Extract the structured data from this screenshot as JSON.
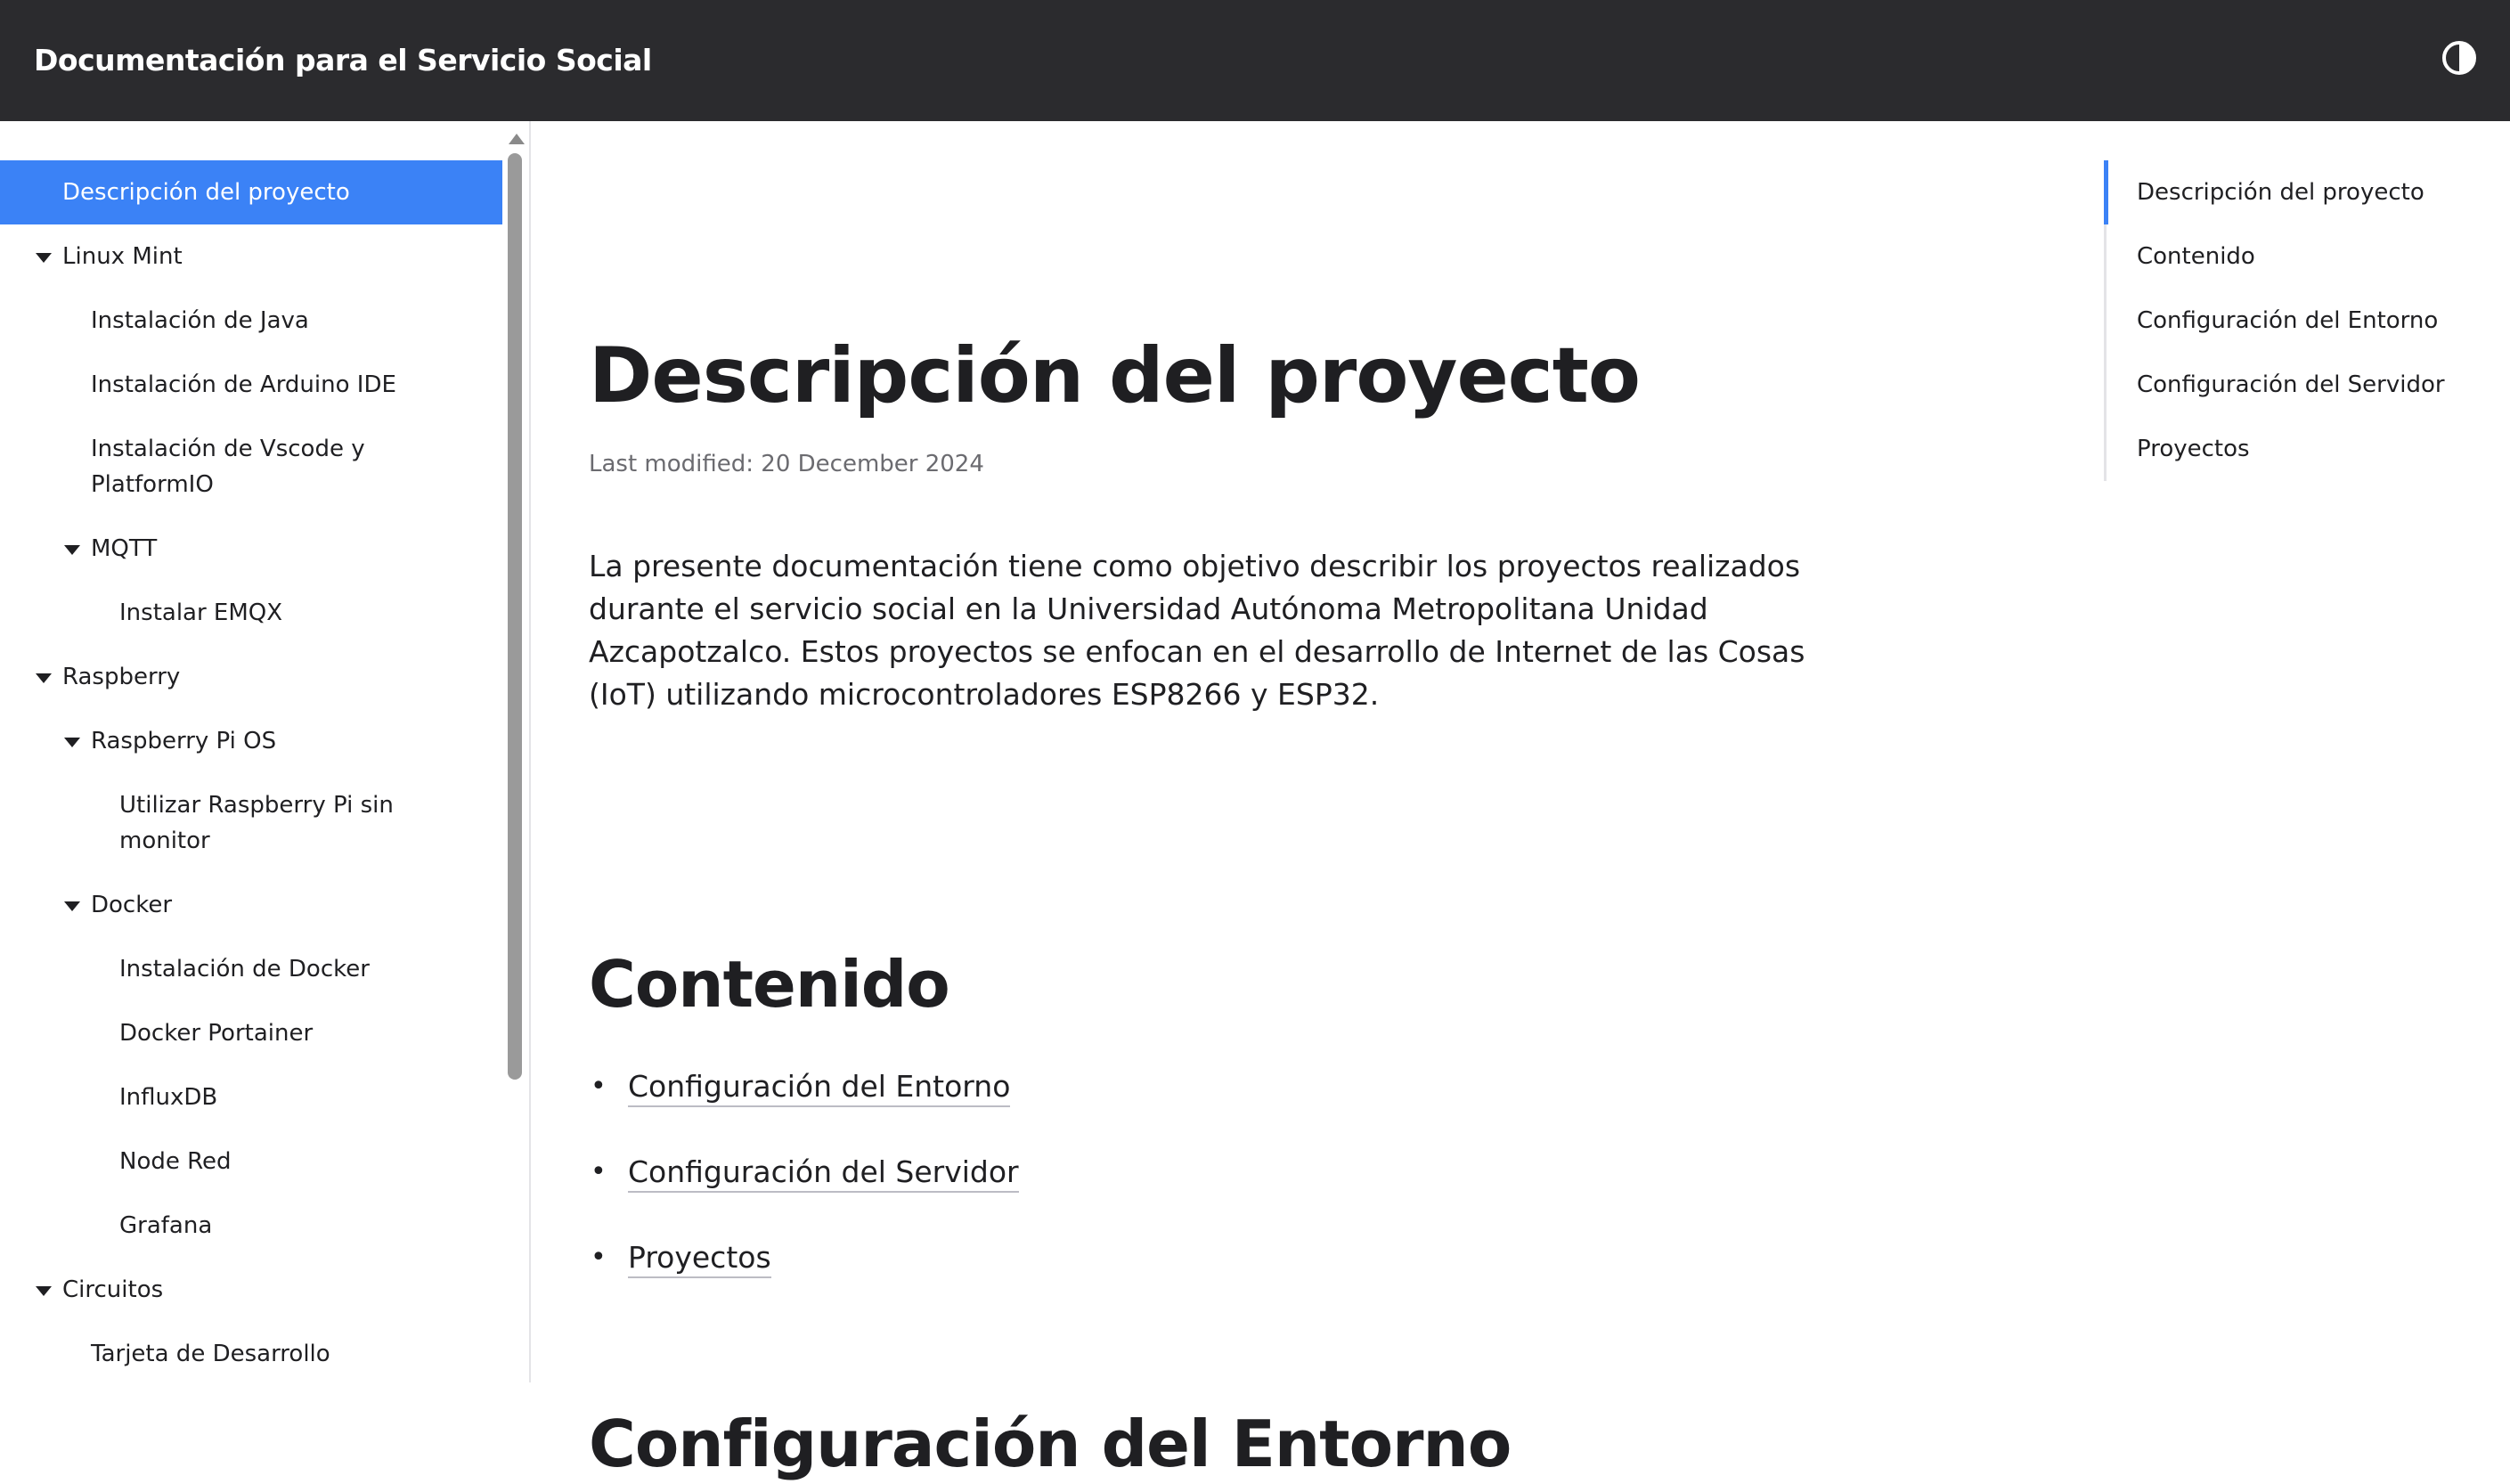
{
  "header": {
    "title": "Documentación para el Servicio Social",
    "theme_toggle_icon": "contrast-icon"
  },
  "sidebar": {
    "items": [
      {
        "label": "Descripción del proyecto"
      },
      {
        "label": "Linux Mint"
      },
      {
        "label": "Instalación de Java"
      },
      {
        "label": "Instalación de Arduino IDE"
      },
      {
        "label": "Instalación de Vscode y PlatformIO"
      },
      {
        "label": "MQTT"
      },
      {
        "label": "Instalar EMQX"
      },
      {
        "label": "Raspberry"
      },
      {
        "label": "Raspberry Pi OS"
      },
      {
        "label": "Utilizar Raspberry Pi sin monitor"
      },
      {
        "label": "Docker"
      },
      {
        "label": "Instalación de Docker"
      },
      {
        "label": "Docker Portainer"
      },
      {
        "label": "InfluxDB"
      },
      {
        "label": "Node Red"
      },
      {
        "label": "Grafana"
      },
      {
        "label": "Circuitos"
      },
      {
        "label": "Tarjeta de Desarrollo"
      }
    ]
  },
  "main": {
    "title": "Descripción del proyecto",
    "last_modified": "Last modified: 20 December 2024",
    "intro": "La presente documentación tiene como objetivo describir los proyectos realizados durante el servicio social en la Universidad Autónoma Metropolitana Unidad Azcapotzalco. Estos proyectos se enfocan en el desarrollo de Internet de las Cosas (IoT) utilizando microcontroladores ESP8266 y ESP32.",
    "contents_heading": "Contenido",
    "contents_links": [
      "Configuración del Entorno",
      "Configuración del Servidor",
      "Proyectos"
    ],
    "next_heading": "Configuración del Entorno"
  },
  "toc": {
    "items": [
      "Descripción del proyecto",
      "Contenido",
      "Configuración del Entorno",
      "Configuración del Servidor",
      "Proyectos"
    ]
  },
  "colors": {
    "accent": "#3b82f6",
    "header_bg": "#2b2b2e"
  }
}
